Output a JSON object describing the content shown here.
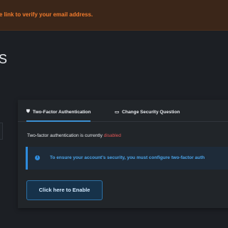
{
  "banner": {
    "text": "e link to verify your email address.",
    "color": "#f07a2c"
  },
  "page": {
    "title": "S"
  },
  "tabs": [
    {
      "icon": "shield-icon",
      "glyph": "⛊",
      "label": "Two-Factor Authentication",
      "active": true
    },
    {
      "icon": "id-card-icon",
      "glyph": "▭",
      "label": "Change Security Question",
      "active": false
    }
  ],
  "status": {
    "prefix": "Two-factor authentication is currently",
    "value": "disabled",
    "value_color": "#e05555"
  },
  "alert": {
    "icon": "info-icon",
    "text": "To ensure your account's security, you must configure two-factor auth"
  },
  "actions": {
    "enable_label": "Click here to Enable"
  },
  "theme": {
    "accent": "#3b8fd1",
    "background": "#1c1f24"
  }
}
